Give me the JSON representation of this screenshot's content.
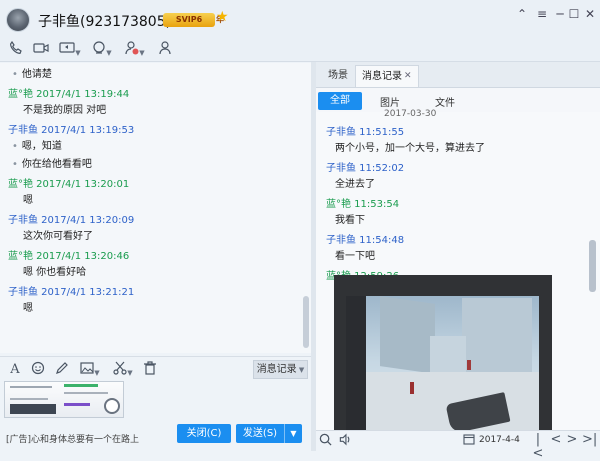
{
  "window": {
    "title": "子非鱼(923173805)",
    "badge_svip": "SVIP6",
    "badge_year": "年",
    "minimize_icon": "─",
    "maximize_icon": "☐",
    "close_icon": "✕",
    "menu_icon": "≡",
    "expand_icon": "⌃",
    "star_icon": "★"
  },
  "toolbar": {
    "icons": [
      "phone-icon",
      "video-icon",
      "screen-share-icon",
      "remote-icon",
      "add-user-icon",
      "friends-icon"
    ]
  },
  "chat": {
    "messages": [
      {
        "kind": "cont",
        "text": "他请楚"
      },
      {
        "kind": "sender",
        "color": "green",
        "sender": "蓝°艳",
        "time": "2017/4/1 13:19:44"
      },
      {
        "kind": "text",
        "text": "不是我的原因 对吧"
      },
      {
        "kind": "sender",
        "color": "blue",
        "sender": "子非鱼",
        "time": "2017/4/1 13:19:53"
      },
      {
        "kind": "cont",
        "text": "嗯，知道"
      },
      {
        "kind": "cont",
        "text": "你在给他看看吧"
      },
      {
        "kind": "sender",
        "color": "green",
        "sender": "蓝°艳",
        "time": "2017/4/1 13:20:01"
      },
      {
        "kind": "text",
        "text": "嗯"
      },
      {
        "kind": "sender",
        "color": "blue",
        "sender": "子非鱼",
        "time": "2017/4/1 13:20:09"
      },
      {
        "kind": "text",
        "text": "这次你可看好了"
      },
      {
        "kind": "sender",
        "color": "green",
        "sender": "蓝°艳",
        "time": "2017/4/1 13:20:46"
      },
      {
        "kind": "text",
        "text": "嗯 你也看好哈"
      },
      {
        "kind": "sender",
        "color": "blue",
        "sender": "子非鱼",
        "time": "2017/4/1 13:21:21"
      },
      {
        "kind": "text",
        "text": "嗯"
      }
    ]
  },
  "input": {
    "history_button": "消息记录",
    "icons": [
      "font-icon",
      "emoji-icon",
      "pen-icon",
      "image-icon",
      "scissors-icon",
      "trash-icon"
    ]
  },
  "bottom": {
    "ad_text": "[广告]心和身体总要有一个在路上",
    "close_button": "关闭(C)",
    "send_button": "发送(S)",
    "send_more": "▼"
  },
  "right_panel": {
    "tab_scene": "场景",
    "tab_history": "消息记录",
    "tab_close": "✕",
    "filter_all": "全部",
    "filter_image": "图片",
    "filter_file": "文件",
    "date_header": "2017-03-30",
    "messages": [
      {
        "kind": "sender",
        "color": "blue",
        "sender": "子非鱼",
        "time": "11:51:55"
      },
      {
        "kind": "text",
        "text": "两个小号，加一个大号，算进去了"
      },
      {
        "kind": "sender",
        "color": "blue",
        "sender": "子非鱼",
        "time": "11:52:02"
      },
      {
        "kind": "text",
        "text": "全进去了"
      },
      {
        "kind": "sender",
        "color": "green",
        "sender": "蓝°艳",
        "time": "11:53:54"
      },
      {
        "kind": "text",
        "text": "我看下"
      },
      {
        "kind": "sender",
        "color": "blue",
        "sender": "子非鱼",
        "time": "11:54:48"
      },
      {
        "kind": "text",
        "text": "看一下吧"
      },
      {
        "kind": "sender",
        "color": "green",
        "sender": "蓝°艳",
        "time": "12:59:26"
      }
    ],
    "footer_date": "2017-4-4",
    "nav_first": "|<",
    "nav_prev": "<",
    "nav_next": ">",
    "nav_last": ">|"
  }
}
